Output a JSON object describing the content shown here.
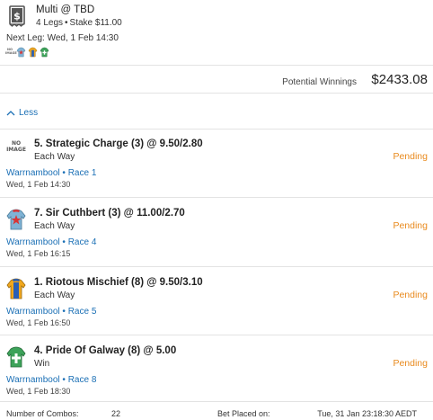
{
  "header": {
    "title": "Multi @ TBD",
    "legs": "4 Legs",
    "separator": "•",
    "stake": "Stake $11.00"
  },
  "next_leg": "Next Leg: Wed, 1 Feb 14:30",
  "mini_silks": [
    "no-image",
    "red-star-silk",
    "orange-blue-silk",
    "green-cross-silk"
  ],
  "mini_no_image_text": "NO IMAGE",
  "potential_winnings": {
    "label": "Potential Winnings",
    "value": "$2433.08"
  },
  "toggle": {
    "label": "Less"
  },
  "legs": [
    {
      "title": "5. Strategic Charge (3) @ 9.50/2.80",
      "bet_type": "Each Way",
      "status": "Pending",
      "race": "Warrnambool • Race 1",
      "time": "Wed, 1 Feb 14:30",
      "silk": "no-image",
      "no_image_text": "NO IMAGE"
    },
    {
      "title": "7. Sir Cuthbert (3) @ 11.00/2.70",
      "bet_type": "Each Way",
      "status": "Pending",
      "race": "Warrnambool • Race 4",
      "time": "Wed, 1 Feb 16:15",
      "silk": "red-star-silk"
    },
    {
      "title": "1. Riotous Mischief (8) @ 9.50/3.10",
      "bet_type": "Each Way",
      "status": "Pending",
      "race": "Warrnambool • Race 5",
      "time": "Wed, 1 Feb 16:50",
      "silk": "orange-blue-silk"
    },
    {
      "title": "4. Pride Of Galway (8) @ 5.00",
      "bet_type": "Win",
      "status": "Pending",
      "race": "Warrnambool • Race 8",
      "time": "Wed, 1 Feb 18:30",
      "silk": "green-cross-silk"
    }
  ],
  "footer": {
    "combos_label": "Number of Combos:",
    "combos_value": "22",
    "placed_label": "Bet Placed on:",
    "placed_value": "Tue, 31 Jan 23:18:30 AEDT"
  },
  "colors": {
    "link": "#1a6fb5",
    "pending": "#e98a1d",
    "divider": "#e3e3e3"
  }
}
